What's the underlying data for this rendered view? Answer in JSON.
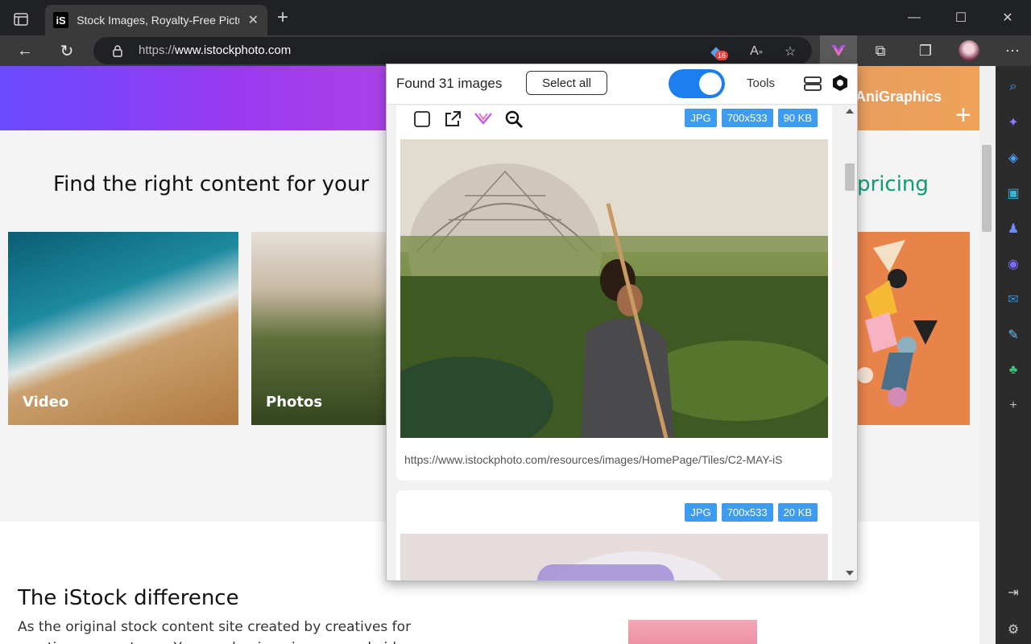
{
  "browser": {
    "tab_title": "Stock Images, Royalty-Free Pictur",
    "favicon_text": "iS",
    "address_prefix": "https://",
    "address_host": "www.istockphoto.com",
    "notification_count": "16"
  },
  "page": {
    "hero_label": "AniGraphics",
    "headline": "Find the right content for your",
    "pricing_text": "pricing",
    "tiles": [
      {
        "label": "Video"
      },
      {
        "label": "Photos"
      }
    ],
    "difference_title": "The iStock difference",
    "difference_body": "As the original stock content site created by creatives for creatives, we get you. You need unique images and videos"
  },
  "popup": {
    "found_text": "Found 31 images",
    "select_all": "Select all",
    "tools": "Tools",
    "toggle_on": true,
    "cards": [
      {
        "format": "JPG",
        "dimensions": "700x533",
        "size": "90 KB",
        "url": "https://www.istockphoto.com/resources/images/HomePage/Tiles/C2-MAY-iS"
      },
      {
        "format": "JPG",
        "dimensions": "700x533",
        "size": "20 KB"
      }
    ]
  },
  "colors": {
    "toggle": "#1c7ff0",
    "chip": "#3d9bf0",
    "pricing": "#0f9a75"
  }
}
